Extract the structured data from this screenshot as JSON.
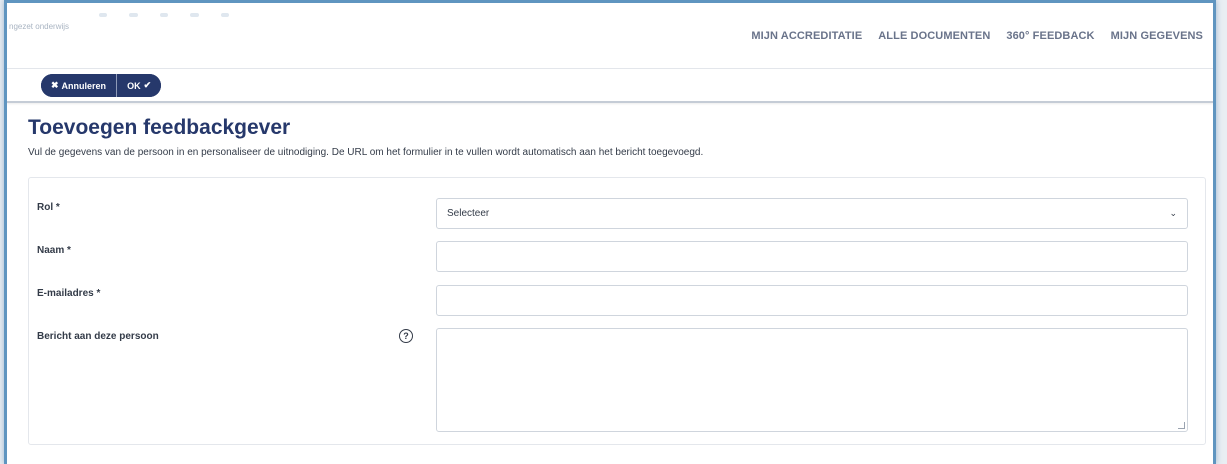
{
  "header": {
    "tagline": "ngezet onderwijs",
    "nav": [
      {
        "label": "MIJN ACCREDITATIE"
      },
      {
        "label": "ALLE DOCUMENTEN"
      },
      {
        "label": "360° FEEDBACK"
      },
      {
        "label": "MIJN GEGEVENS"
      }
    ]
  },
  "toolbar": {
    "cancel_label": "Annuleren",
    "ok_label": "OK"
  },
  "page": {
    "title": "Toevoegen feedbackgever",
    "subtitle": "Vul de gegevens van de persoon in en personaliseer de uitnodiging. De URL om het formulier in te vullen wordt automatisch aan het bericht toegevoegd."
  },
  "form": {
    "role_label": "Rol *",
    "role_value": "Selecteer",
    "name_label": "Naam *",
    "name_value": "",
    "email_label": "E-mailadres *",
    "email_value": "",
    "message_label": "Bericht aan deze persoon",
    "message_value": ""
  },
  "colors": {
    "brand": "#26386b",
    "frame": "#5f95c0"
  }
}
